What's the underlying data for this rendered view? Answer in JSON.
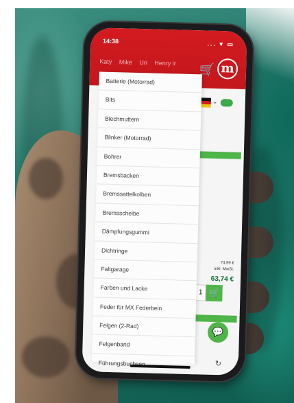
{
  "status": {
    "time": "14:38",
    "icons": "... ▾ ▭"
  },
  "header": {
    "names": [
      "Katy",
      "Mike",
      "Uri",
      "Henry ir"
    ],
    "cart_icon": "cart-icon",
    "logo_letter": "m"
  },
  "dropdown": {
    "items": [
      "Batterie (Motorrad)",
      "Bits",
      "Blechmuttern",
      "Blinker (Motorrad)",
      "Bohrer",
      "Bremsbacken",
      "Bremssattelkolben",
      "Bremsscheibe",
      "Dämpfungsgummi",
      "Dichtringe",
      "Faltgarage",
      "Farben und Lacke",
      "Feder für MX Federbein",
      "Felgen (2-Rad)",
      "Felgenband",
      "Führungsbuchsen"
    ]
  },
  "product": {
    "price_old": "74,99 €",
    "price_vat": "inkl. MwSt.",
    "price_new": "63,74 €",
    "quantity": "1",
    "stray_number": "1"
  },
  "colors": {
    "brand": "#c3171c",
    "accent": "#4fb548"
  }
}
